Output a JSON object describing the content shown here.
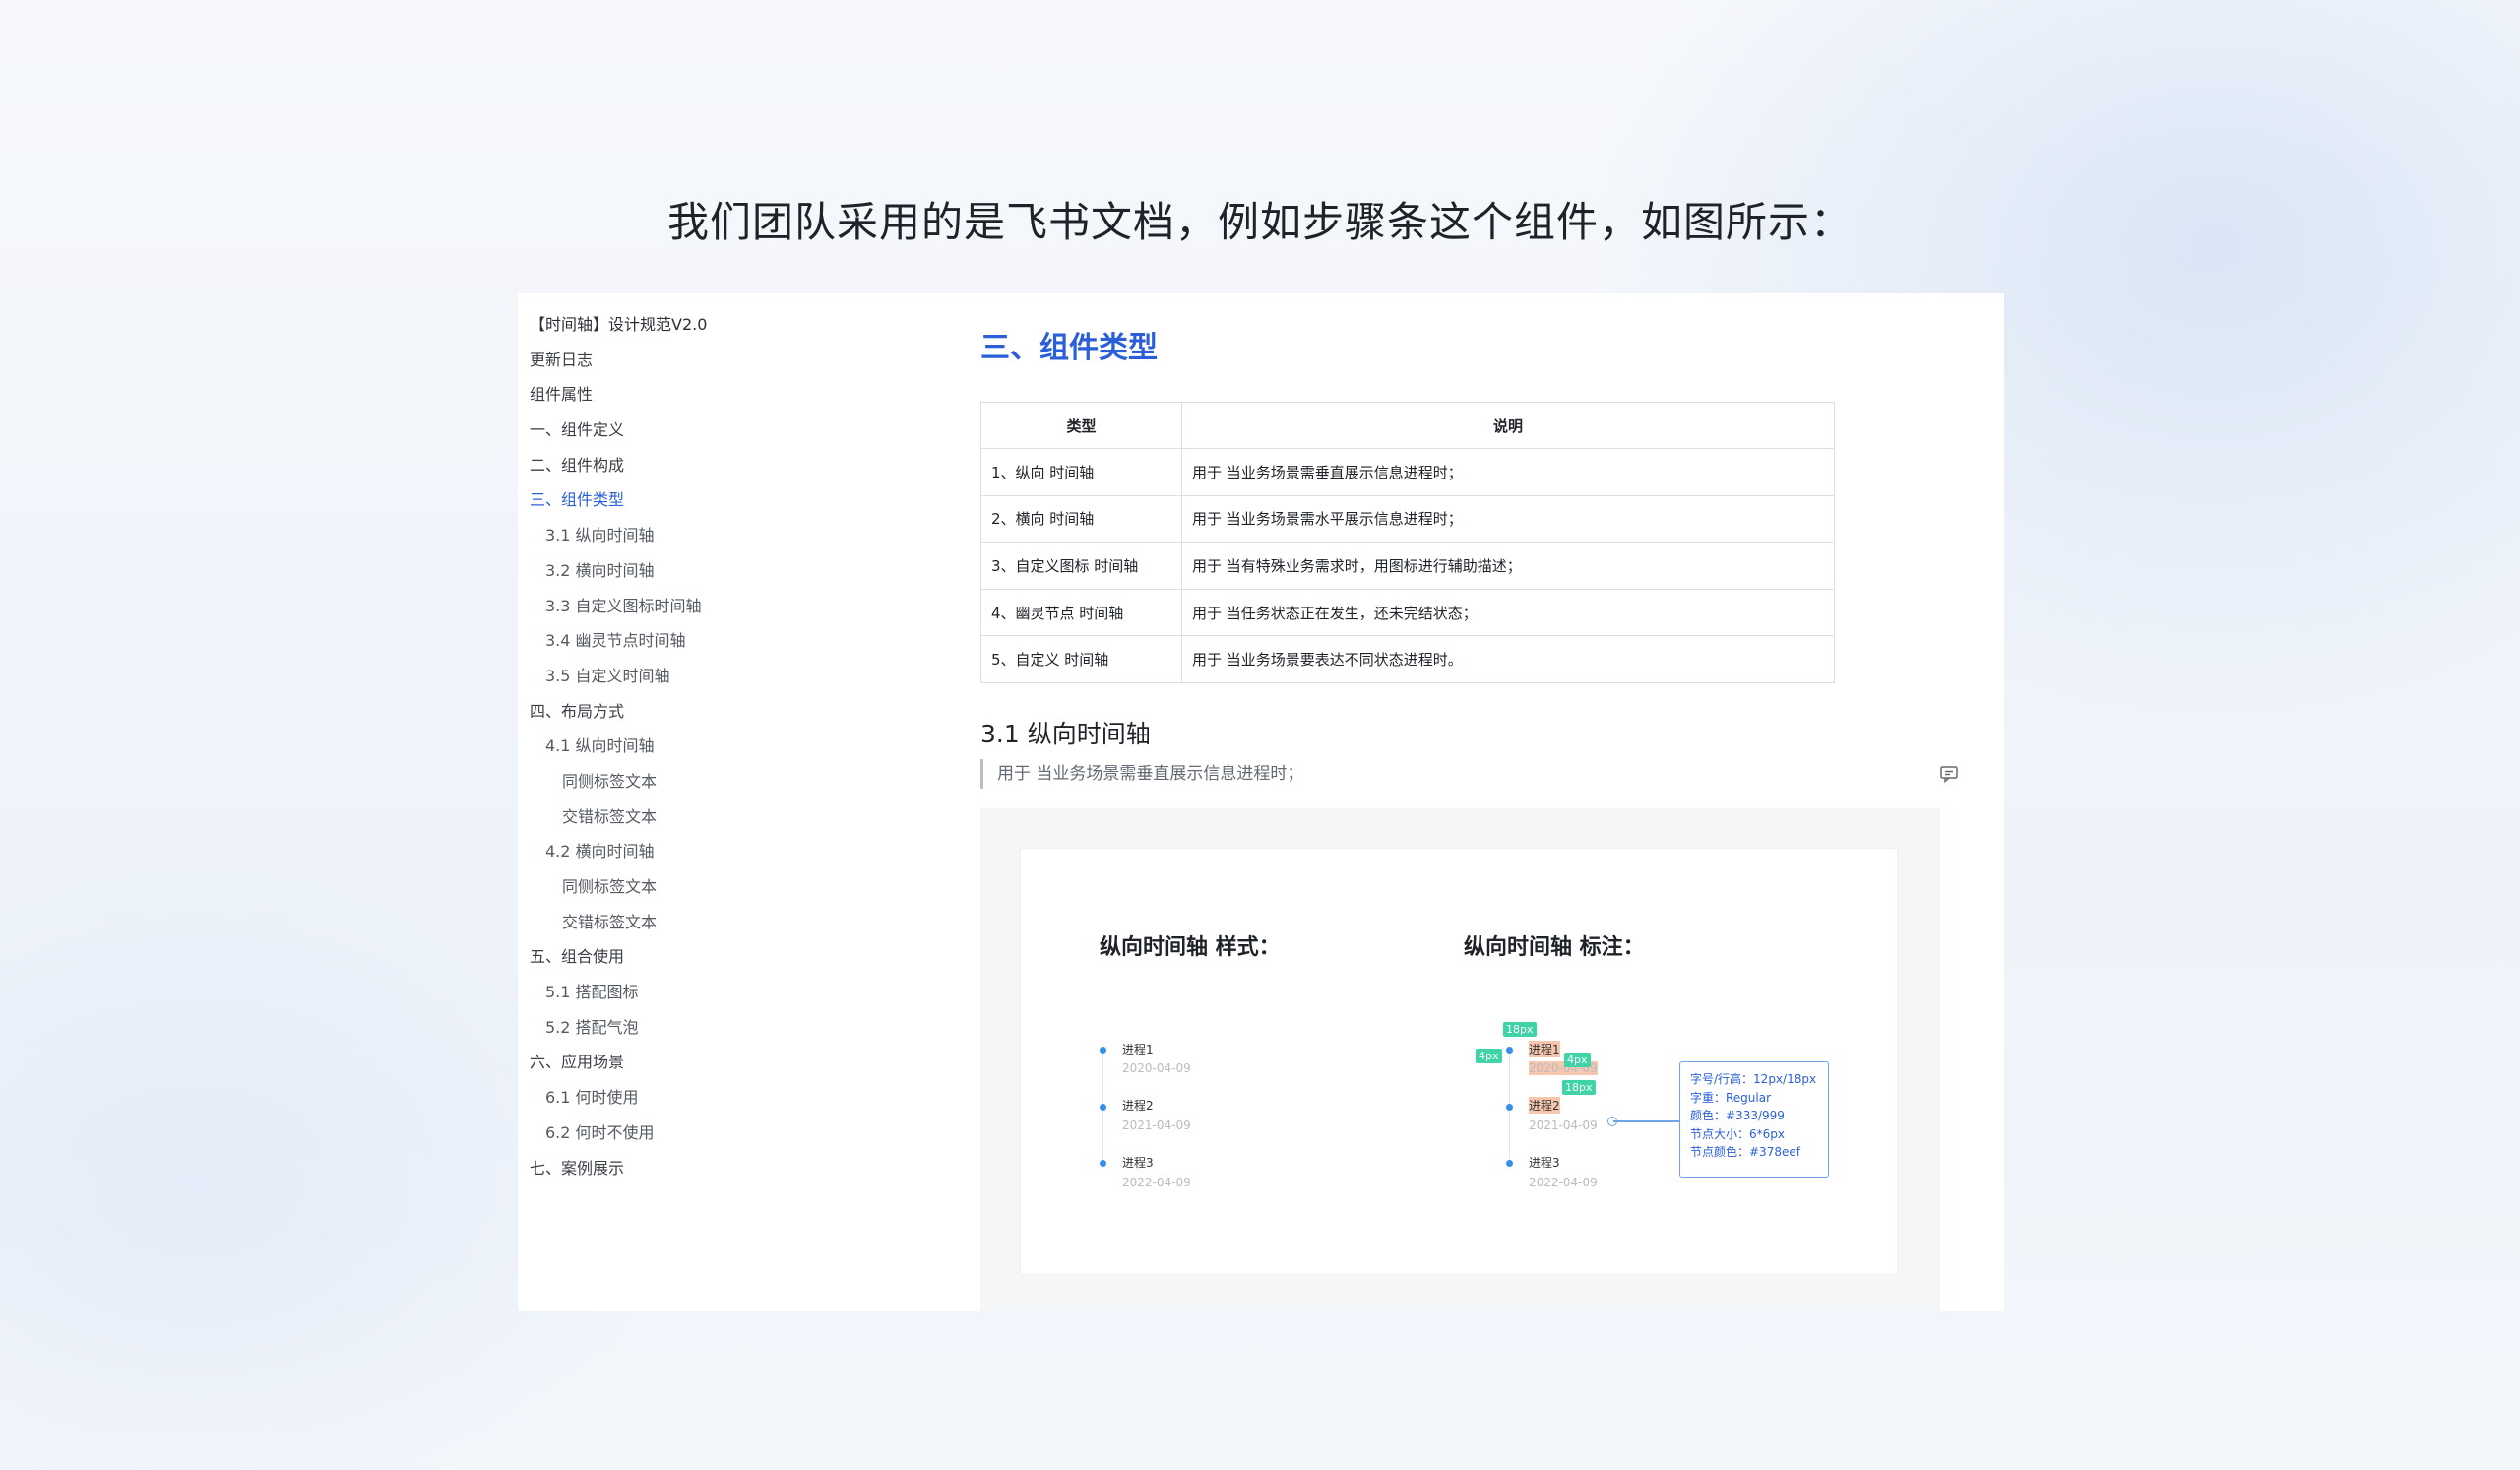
{
  "headline": "我们团队采用的是飞书文档，例如步骤条这个组件，如图所示：",
  "toc": {
    "doc_title": "【时间轴】设计规范V2.0",
    "items": [
      {
        "label": "更新日志",
        "level": 0
      },
      {
        "label": "组件属性",
        "level": 0
      },
      {
        "label": "一、组件定义",
        "level": 0
      },
      {
        "label": "二、组件构成",
        "level": 0
      },
      {
        "label": "三、组件类型",
        "level": 0,
        "active": true
      },
      {
        "label": "3.1 纵向时间轴",
        "level": 1
      },
      {
        "label": "3.2 横向时间轴",
        "level": 1
      },
      {
        "label": "3.3 自定义图标时间轴",
        "level": 1
      },
      {
        "label": "3.4 幽灵节点时间轴",
        "level": 1
      },
      {
        "label": "3.5 自定义时间轴",
        "level": 1
      },
      {
        "label": "四、布局方式",
        "level": 0
      },
      {
        "label": "4.1 纵向时间轴",
        "level": 1
      },
      {
        "label": "同侧标签文本",
        "level": 2
      },
      {
        "label": "交错标签文本",
        "level": 2
      },
      {
        "label": "4.2 横向时间轴",
        "level": 1
      },
      {
        "label": "同侧标签文本",
        "level": 2
      },
      {
        "label": "交错标签文本",
        "level": 2
      },
      {
        "label": "五、组合使用",
        "level": 0
      },
      {
        "label": "5.1 搭配图标",
        "level": 1
      },
      {
        "label": "5.2 搭配气泡",
        "level": 1
      },
      {
        "label": "六、应用场景",
        "level": 0
      },
      {
        "label": "6.1 何时使用",
        "level": 1
      },
      {
        "label": "6.2 何时不使用",
        "level": 1
      },
      {
        "label": "七、案例展示",
        "level": 0
      }
    ]
  },
  "content": {
    "section_title": "三、组件类型",
    "table": {
      "headers": [
        "类型",
        "说明"
      ],
      "rows": [
        [
          "1、纵向 时间轴",
          "用于 当业务场景需垂直展示信息进程时；"
        ],
        [
          "2、横向 时间轴",
          "用于 当业务场景需水平展示信息进程时；"
        ],
        [
          "3、自定义图标 时间轴",
          "用于 当有特殊业务需求时，用图标进行辅助描述；"
        ],
        [
          "4、幽灵节点 时间轴",
          "用于 当任务状态正在发生，还未完结状态；"
        ],
        [
          "5、自定义 时间轴",
          "用于 当业务场景要表达不同状态进程时。"
        ]
      ]
    },
    "sub_title": "3.1 纵向时间轴",
    "quote": "用于 当业务场景需垂直展示信息进程时；",
    "preview": {
      "left_title": "纵向时间轴 样式：",
      "right_title": "纵向时间轴 标注：",
      "steps": [
        {
          "name": "进程1",
          "date": "2020-04-09"
        },
        {
          "name": "进程2",
          "date": "2021-04-09"
        },
        {
          "name": "进程3",
          "date": "2022-04-09"
        }
      ],
      "tags": {
        "t1": "18px",
        "t2": "4px",
        "t3": "4px",
        "t4": "18px"
      },
      "spec": [
        "字号/行高：12px/18px",
        "字重：Regular",
        "颜色：#333/999",
        "节点大小：6*6px",
        "节点颜色：#378eef"
      ]
    }
  },
  "colors": {
    "accent": "#2b5fd9",
    "node": "#378eef",
    "tag": "#3fd3a8",
    "highlight": "#f7c6ae"
  }
}
